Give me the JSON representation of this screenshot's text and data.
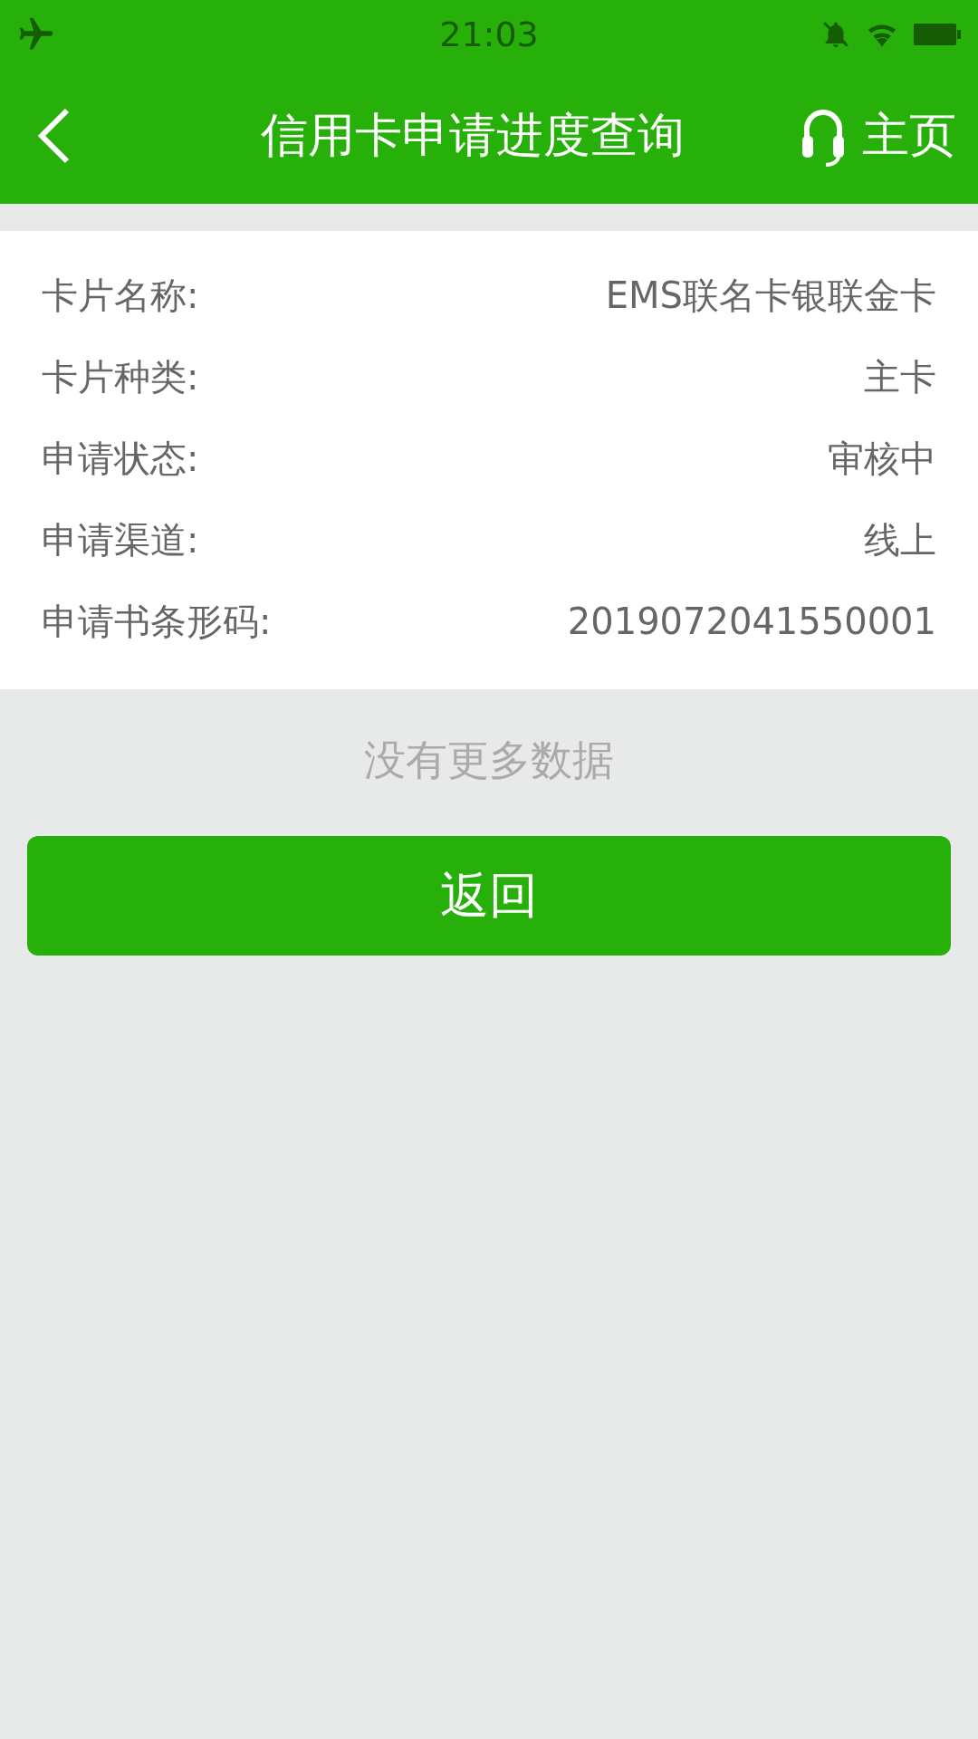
{
  "status_bar": {
    "time": "21:03"
  },
  "header": {
    "title": "信用卡申请进度查询",
    "home_label": "主页"
  },
  "details": [
    {
      "label": "卡片名称:",
      "value": "EMS联名卡银联金卡"
    },
    {
      "label": "卡片种类:",
      "value": "主卡"
    },
    {
      "label": "申请状态:",
      "value": "审核中"
    },
    {
      "label": "申请渠道:",
      "value": "线上"
    },
    {
      "label": "申请书条形码:",
      "value": "2019072041550001"
    }
  ],
  "footer_note": "没有更多数据",
  "return_button": "返回"
}
